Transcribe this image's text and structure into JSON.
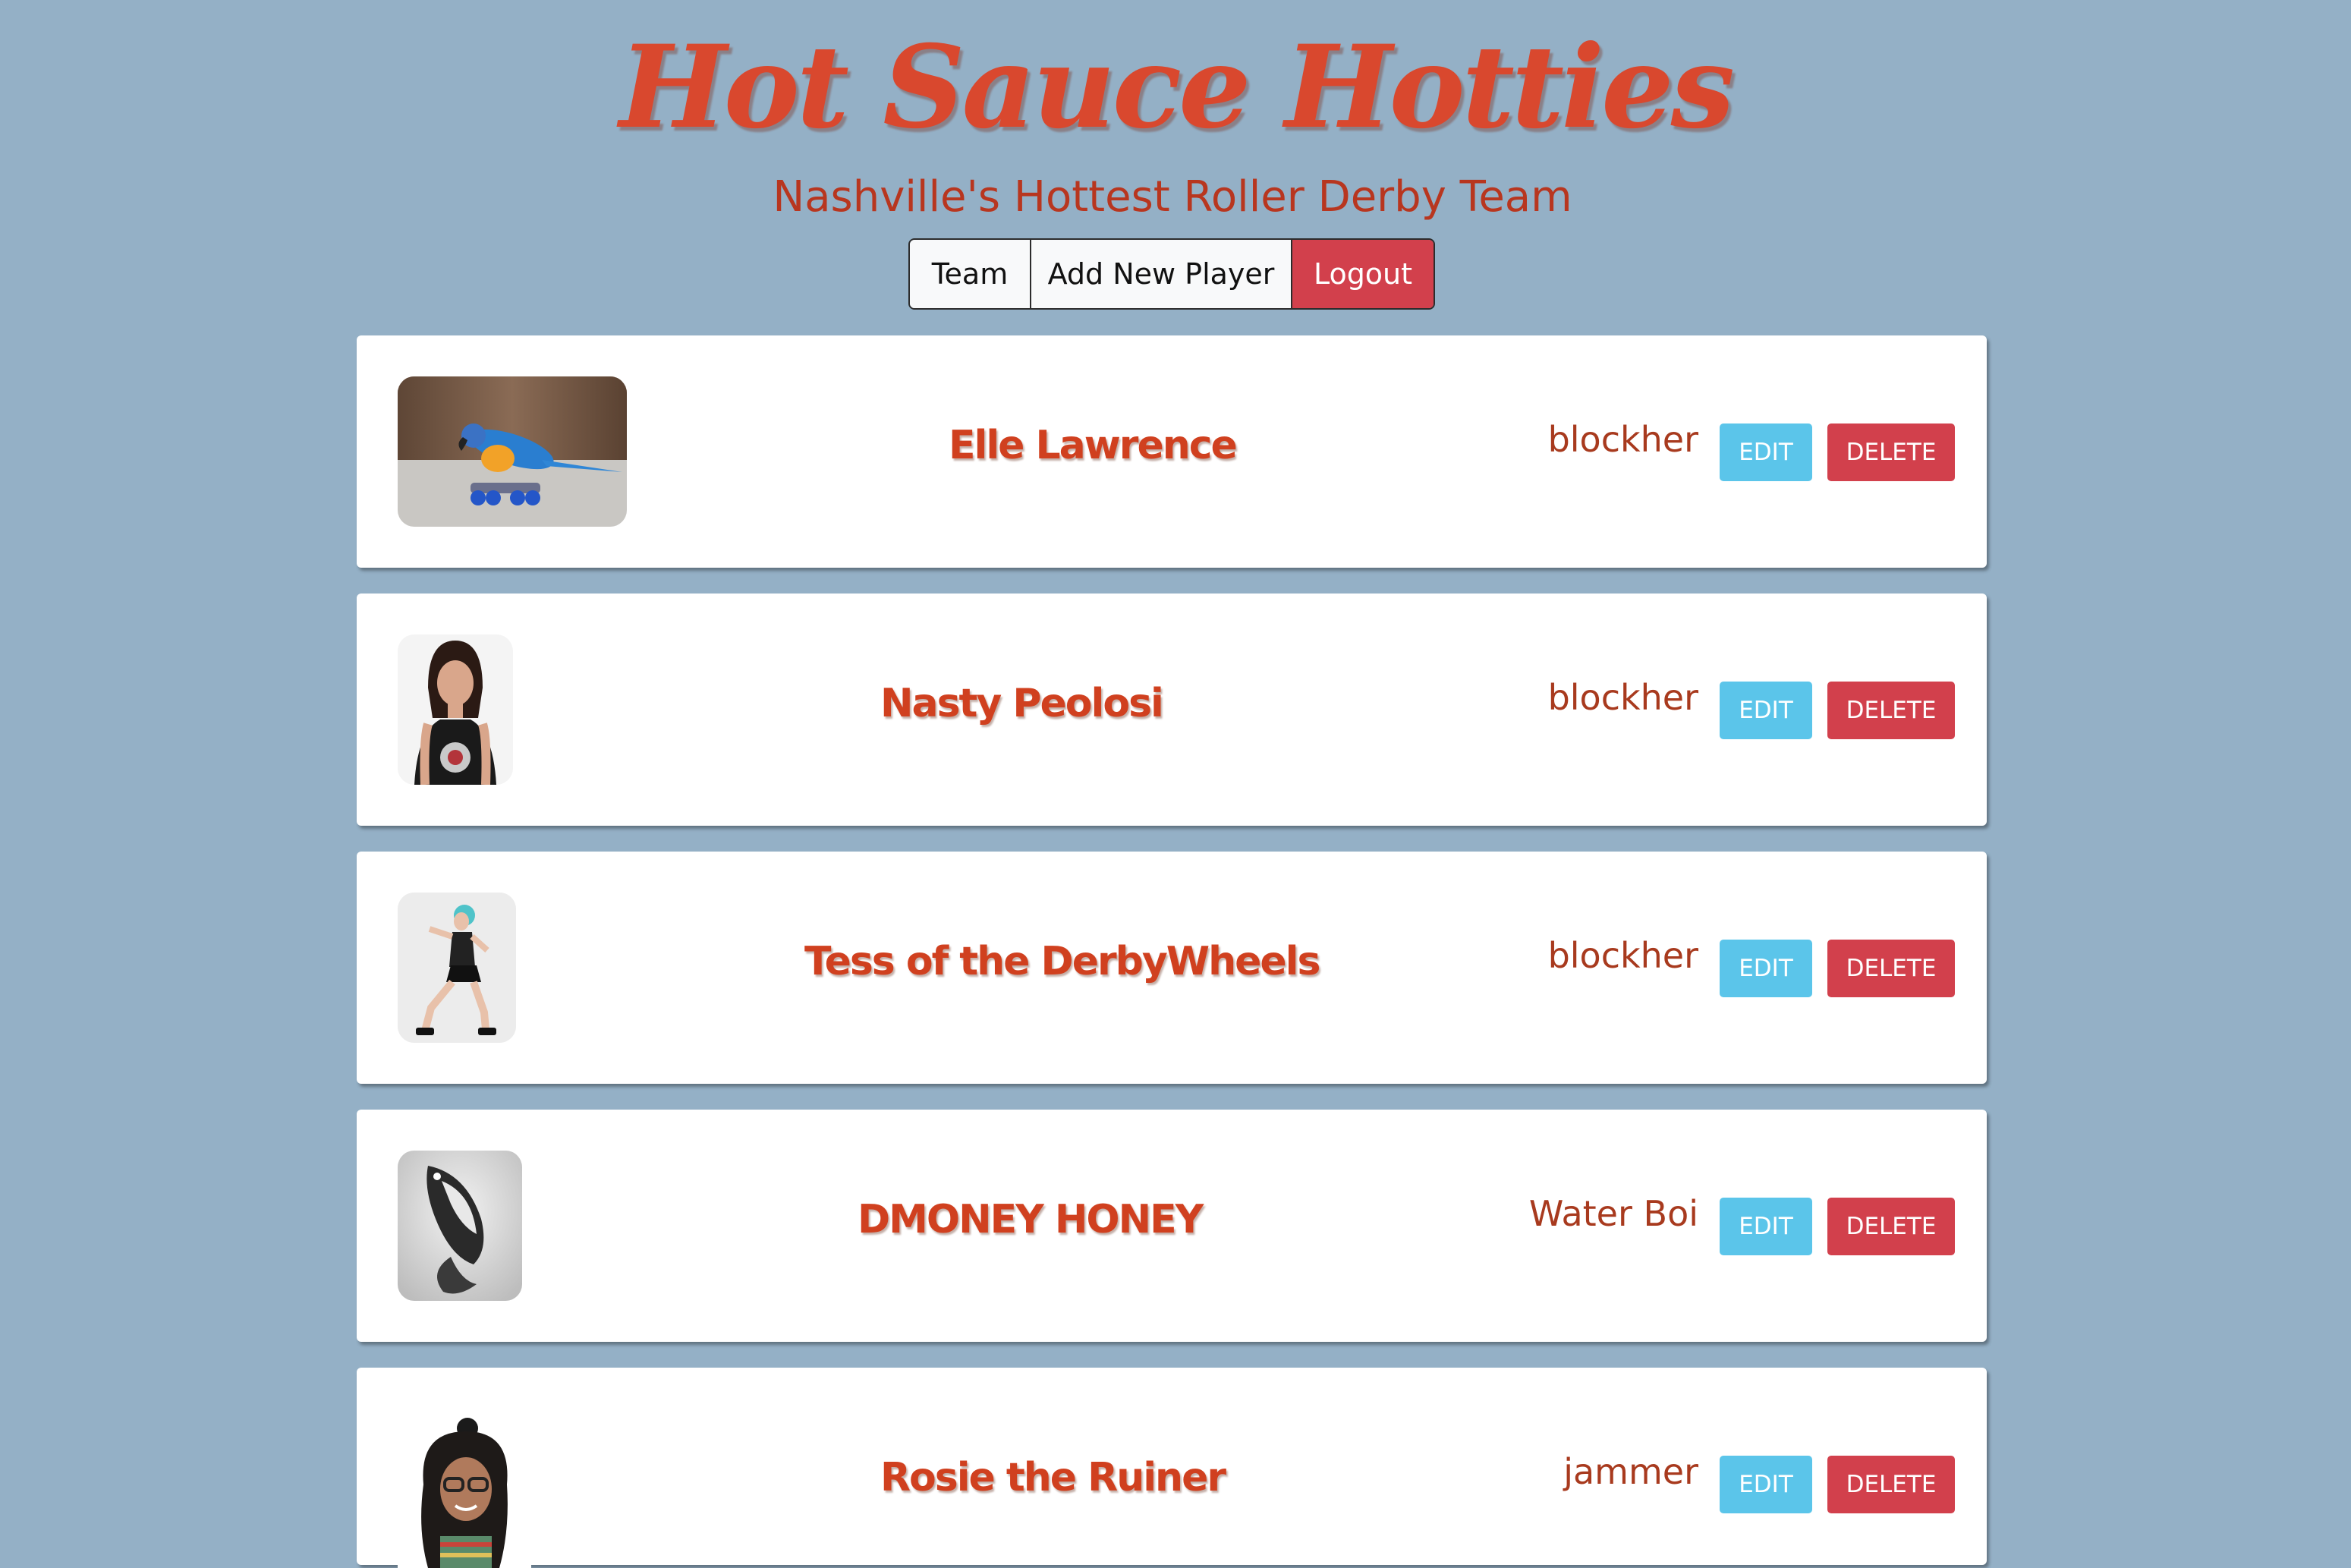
{
  "header": {
    "title": "Hot Sauce Hotties",
    "tagline": "Nashville's Hottest Roller Derby Team"
  },
  "nav": {
    "team_label": "Team",
    "add_label": "Add New Player",
    "logout_label": "Logout"
  },
  "players": [
    {
      "name": "Elle Lawrence",
      "position": "blockher",
      "edit_label": "EDIT",
      "delete_label": "DELETE",
      "photo_icon": "parrot-on-skates-photo"
    },
    {
      "name": "Nasty Peolosi",
      "position": "blockher",
      "edit_label": "EDIT",
      "delete_label": "DELETE",
      "photo_icon": "player-portrait-photo"
    },
    {
      "name": "Tess of the DerbyWheels",
      "position": "blockher",
      "edit_label": "EDIT",
      "delete_label": "DELETE",
      "photo_icon": "skater-full-body-photo"
    },
    {
      "name": "DMONEY HONEY",
      "position": "Water Boi",
      "edit_label": "EDIT",
      "delete_label": "DELETE",
      "photo_icon": "penguin-photo"
    },
    {
      "name": "Rosie the Ruiner",
      "position": "jammer",
      "edit_label": "EDIT",
      "delete_label": "DELETE",
      "photo_icon": "player-portrait-photo"
    }
  ],
  "colors": {
    "background": "#94b0c6",
    "brand": "#d9482e",
    "edit": "#5bc5ea",
    "delete": "#d2404c"
  }
}
